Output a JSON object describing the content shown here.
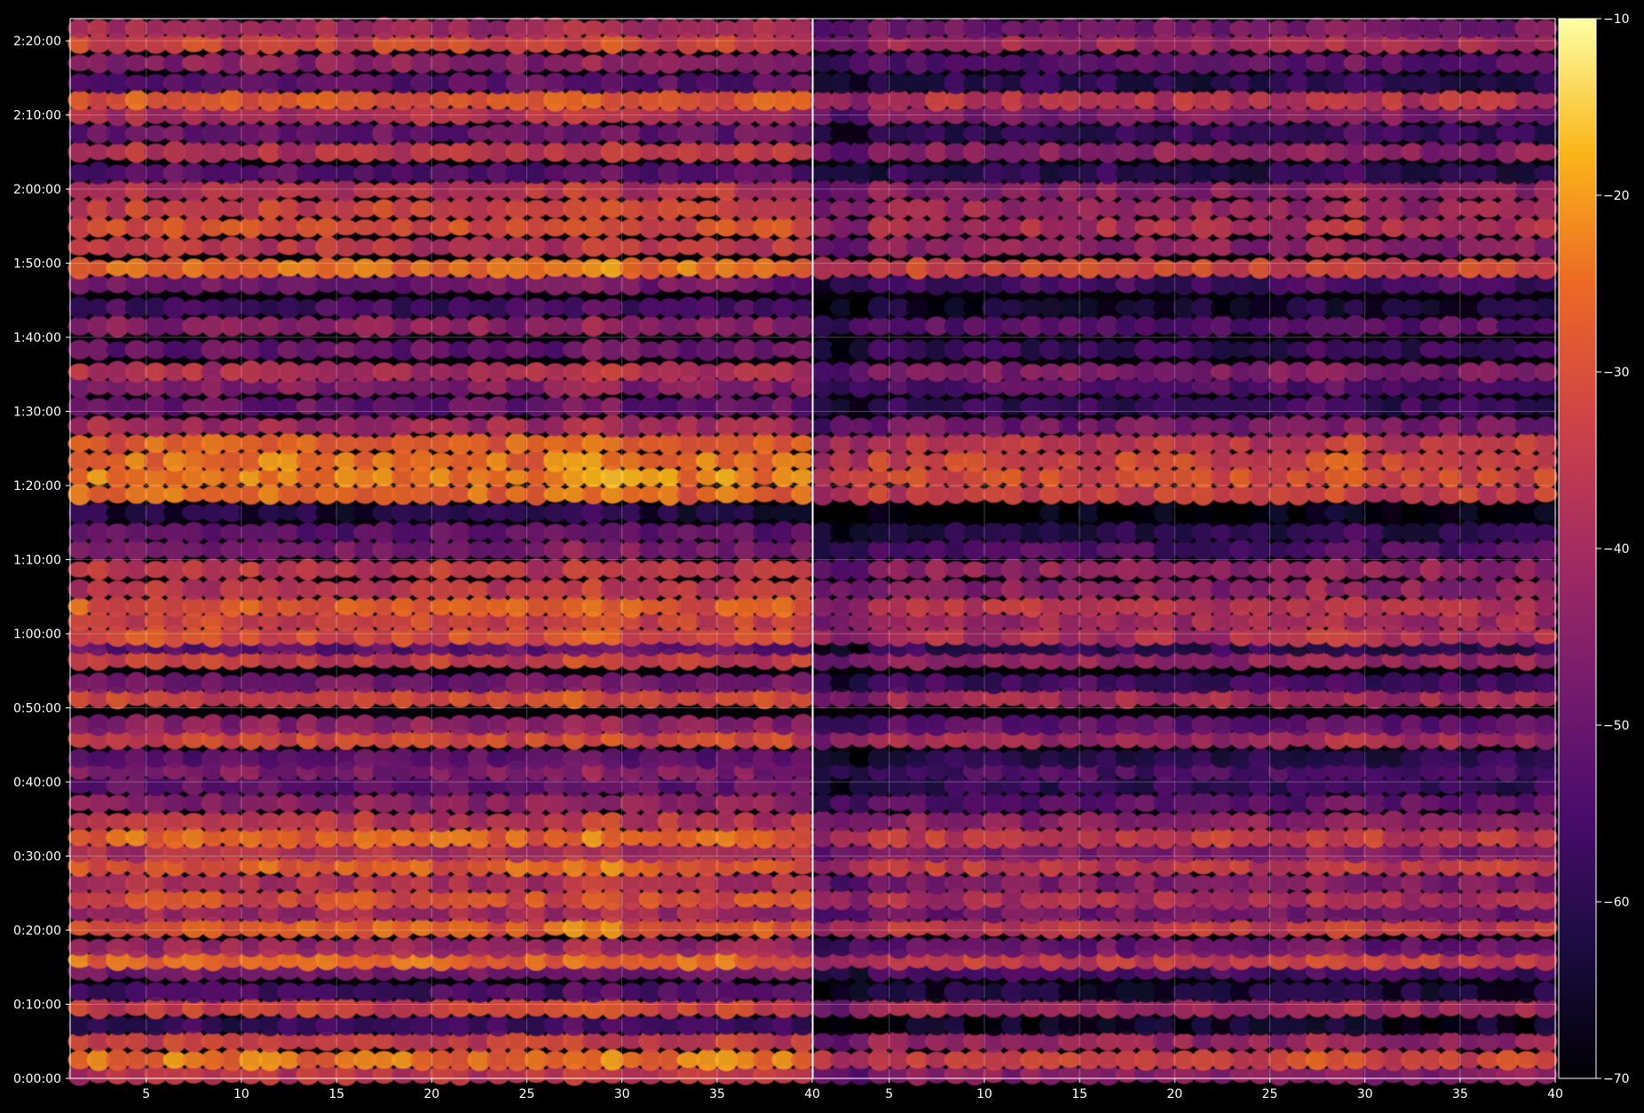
{
  "chart_data": {
    "type": "heatmap",
    "background": "#000000",
    "colormap": "inferno",
    "grid": true,
    "panels": [
      {
        "name": "left",
        "xlim": [
          1,
          40
        ],
        "xticks": [
          5,
          10,
          15,
          20,
          25,
          30,
          35,
          40
        ],
        "xtick_labels": [
          "5",
          "10",
          "15",
          "20",
          "25",
          "30",
          "35",
          "40"
        ]
      },
      {
        "name": "right",
        "xlim": [
          1,
          40
        ],
        "xticks": [
          5,
          10,
          15,
          20,
          25,
          30,
          35,
          40
        ],
        "xtick_labels": [
          "5",
          "10",
          "15",
          "20",
          "25",
          "30",
          "35",
          "40"
        ]
      }
    ],
    "ylim_seconds": [
      0,
      8580
    ],
    "yticks_seconds": [
      0,
      600,
      1200,
      1800,
      2400,
      3000,
      3600,
      4200,
      4800,
      5400,
      6000,
      6600,
      7200,
      7800,
      8400
    ],
    "ytick_labels": [
      "0:00:00",
      "0:10:00",
      "0:20:00",
      "0:30:00",
      "0:40:00",
      "0:50:00",
      "1:00:00",
      "1:10:00",
      "1:20:00",
      "1:30:00",
      "1:40:00",
      "1:50:00",
      "2:00:00",
      "2:10:00",
      "2:20:00"
    ],
    "colorbar": {
      "vmin": -70,
      "vmax": -10,
      "ticks": [
        -70,
        -60,
        -50,
        -40,
        -30,
        -20,
        -10
      ],
      "tick_labels": [
        "−70",
        "−60",
        "−50",
        "−40",
        "−30",
        "−20",
        "−10"
      ]
    },
    "row_levels_dB": [
      {
        "t": 30,
        "v": -36
      },
      {
        "t": 150,
        "v": -24
      },
      {
        "t": 300,
        "v": -34
      },
      {
        "t": 430,
        "v": -58
      },
      {
        "t": 570,
        "v": -33
      },
      {
        "t": 700,
        "v": -55
      },
      {
        "t": 870,
        "v": -48
      },
      {
        "t": 960,
        "v": -26
      },
      {
        "t": 1060,
        "v": -42
      },
      {
        "t": 1220,
        "v": -27
      },
      {
        "t": 1340,
        "v": -40
      },
      {
        "t": 1450,
        "v": -30
      },
      {
        "t": 1580,
        "v": -38
      },
      {
        "t": 1720,
        "v": -27
      },
      {
        "t": 1830,
        "v": -38
      },
      {
        "t": 1950,
        "v": -26
      },
      {
        "t": 2080,
        "v": -36
      },
      {
        "t": 2230,
        "v": -44
      },
      {
        "t": 2370,
        "v": -50
      },
      {
        "t": 2490,
        "v": -46
      },
      {
        "t": 2590,
        "v": -52
      },
      {
        "t": 2750,
        "v": -32
      },
      {
        "t": 2860,
        "v": -44
      },
      {
        "t": 3080,
        "v": -32
      },
      {
        "t": 3200,
        "v": -48
      },
      {
        "t": 3390,
        "v": -34
      },
      {
        "t": 3500,
        "v": -52
      },
      {
        "t": 3580,
        "v": -30
      },
      {
        "t": 3700,
        "v": -32
      },
      {
        "t": 3820,
        "v": -28
      },
      {
        "t": 3960,
        "v": -36
      },
      {
        "t": 4120,
        "v": -35
      },
      {
        "t": 4280,
        "v": -46
      },
      {
        "t": 4420,
        "v": -52
      },
      {
        "t": 4580,
        "v": -62
      },
      {
        "t": 4730,
        "v": -26
      },
      {
        "t": 4870,
        "v": -22
      },
      {
        "t": 5000,
        "v": -24
      },
      {
        "t": 5140,
        "v": -27
      },
      {
        "t": 5280,
        "v": -40
      },
      {
        "t": 5440,
        "v": -50
      },
      {
        "t": 5600,
        "v": -45
      },
      {
        "t": 5720,
        "v": -38
      },
      {
        "t": 5900,
        "v": -50
      },
      {
        "t": 6090,
        "v": -44
      },
      {
        "t": 6240,
        "v": -56
      },
      {
        "t": 6430,
        "v": -48
      },
      {
        "t": 6560,
        "v": -24
      },
      {
        "t": 6730,
        "v": -36
      },
      {
        "t": 6890,
        "v": -30
      },
      {
        "t": 7040,
        "v": -33
      },
      {
        "t": 7190,
        "v": -36
      },
      {
        "t": 7330,
        "v": -52
      },
      {
        "t": 7500,
        "v": -36
      },
      {
        "t": 7650,
        "v": -50
      },
      {
        "t": 7800,
        "v": -38
      },
      {
        "t": 7920,
        "v": -28
      },
      {
        "t": 8060,
        "v": -52
      },
      {
        "t": 8220,
        "v": -44
      },
      {
        "t": 8380,
        "v": -32
      },
      {
        "t": 8500,
        "v": -40
      }
    ],
    "right_panel_offset_dB": -8
  }
}
